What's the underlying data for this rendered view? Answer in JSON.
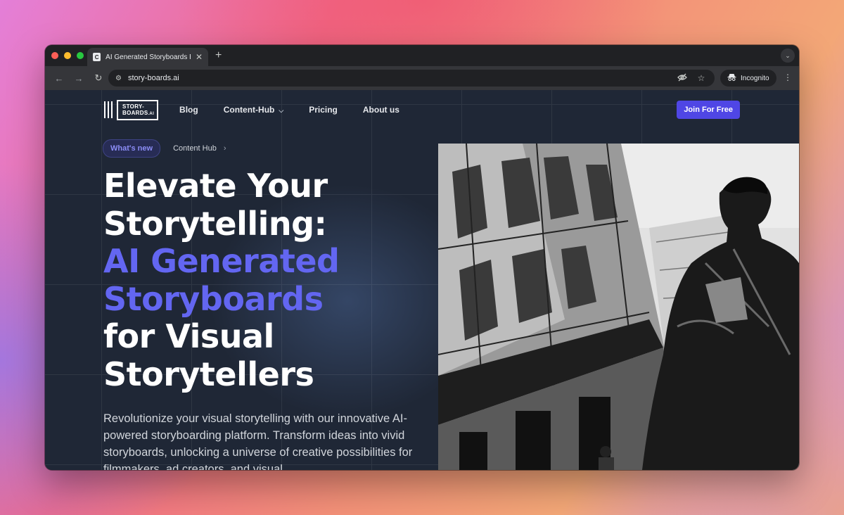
{
  "browser": {
    "tab_title": "AI Generated Storyboards For Visual Storytellers",
    "favicon_letter": "C",
    "new_tab": "+",
    "url": "story-boards.ai",
    "incognito_label": "Incognito"
  },
  "site": {
    "logo_line1": "STORY-",
    "logo_line2": "BOARDS",
    "logo_suffix": ".AI",
    "nav": {
      "blog": "Blog",
      "content_hub": "Content-Hub",
      "pricing": "Pricing",
      "about": "About us"
    },
    "cta": "Join For Free"
  },
  "hero": {
    "pill": "What's new",
    "pill_link": "Content Hub",
    "headline_1": "Elevate Your",
    "headline_2": "Storytelling:",
    "headline_accent_1": "AI Generated",
    "headline_accent_2": "Storyboards",
    "headline_3": "for Visual",
    "headline_4": "Storytellers",
    "description": "Revolutionize your visual storytelling with our innovative AI-powered storyboarding platform. Transform ideas into vivid storyboards, unlocking a universe of creative possibilities for filmmakers, ad creators, and visual"
  },
  "colors": {
    "accent": "#6366f1",
    "cta": "#4f46e5",
    "page_bg": "#1f2736"
  },
  "icons": {
    "back": "arrow-left-icon",
    "forward": "arrow-right-icon",
    "reload": "reload-icon",
    "site_info": "tune-icon",
    "eye_off": "eye-off-icon",
    "star": "star-icon",
    "incognito": "incognito-icon",
    "menu": "kebab-menu-icon"
  }
}
